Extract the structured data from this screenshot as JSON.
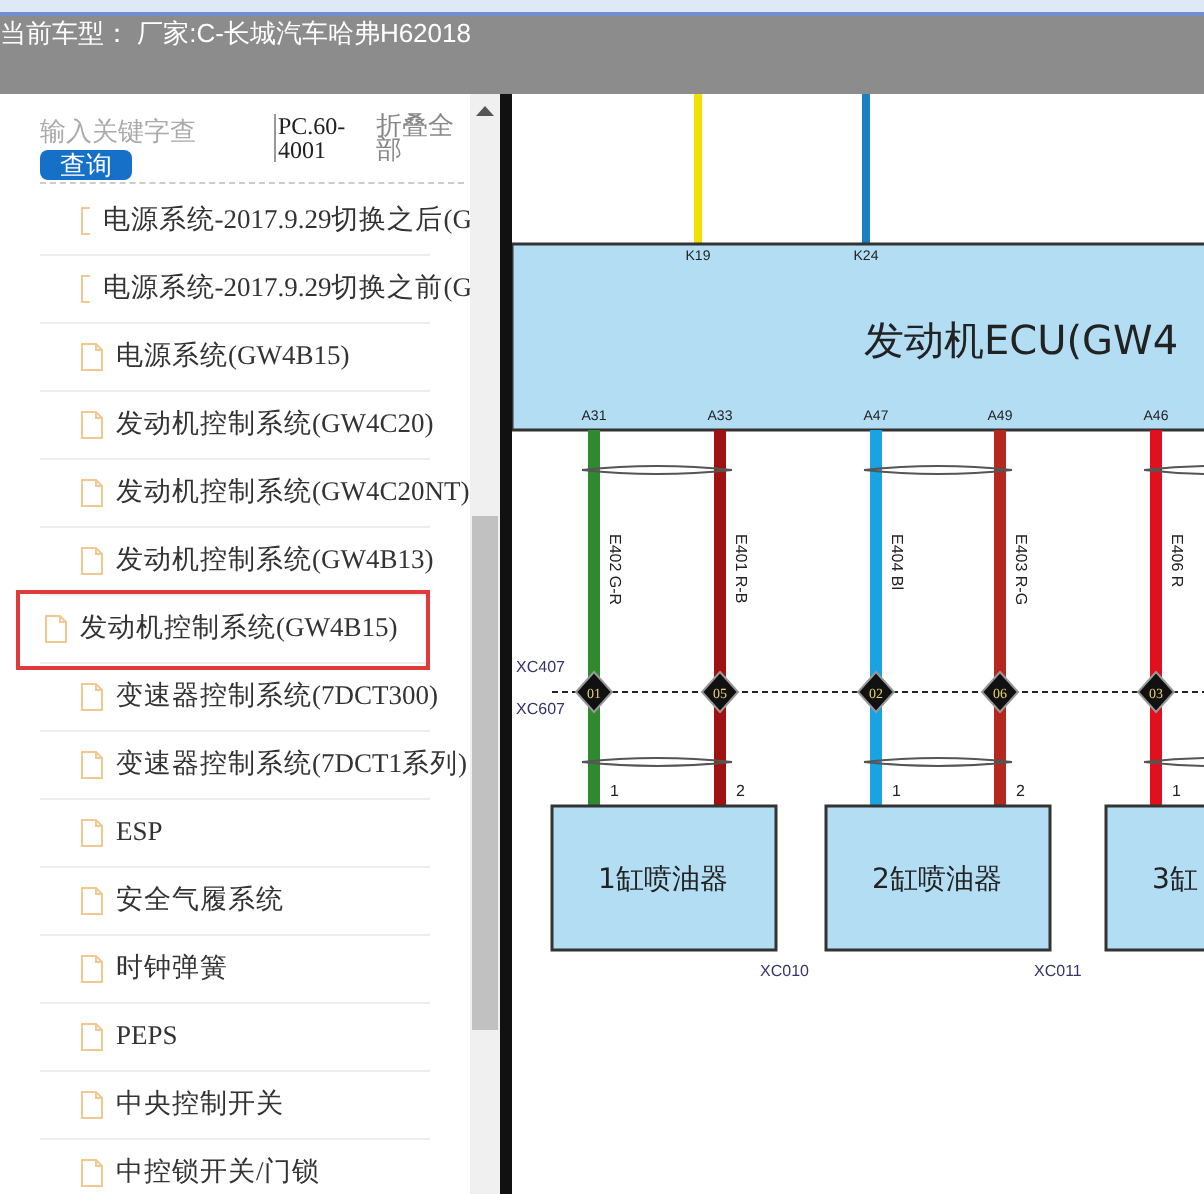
{
  "header": {
    "title": "当前车型： 厂家:C-长城汽车哈弗H62018"
  },
  "sidebar": {
    "search": {
      "placeholder": "输入关键字查"
    },
    "search_button": "查询",
    "code": "PC.60-4001",
    "collapse_all": "折叠全部",
    "items": [
      {
        "label": "电源系统-2017.9.29切换之后(G",
        "selected": false
      },
      {
        "label": "电源系统-2017.9.29切换之前(G",
        "selected": false
      },
      {
        "label": "电源系统(GW4B15)",
        "selected": false
      },
      {
        "label": "发动机控制系统(GW4C20)",
        "selected": false
      },
      {
        "label": "发动机控制系统(GW4C20NT)",
        "selected": false
      },
      {
        "label": "发动机控制系统(GW4B13)",
        "selected": false
      },
      {
        "label": "发动机控制系统(GW4B15)",
        "selected": true
      },
      {
        "label": "变速器控制系统(7DCT300)",
        "selected": false
      },
      {
        "label": "变速器控制系统(7DCT1系列)",
        "selected": false
      },
      {
        "label": "ESP",
        "selected": false
      },
      {
        "label": "安全气履系统",
        "selected": false
      },
      {
        "label": "时钟弹簧",
        "selected": false
      },
      {
        "label": "PEPS",
        "selected": false
      },
      {
        "label": "中央控制开关",
        "selected": false
      },
      {
        "label": "中控锁开关/门锁",
        "selected": false
      }
    ]
  },
  "diagram": {
    "ecu": {
      "title": "发动机ECU(GW4",
      "top_pins": [
        {
          "pin": "K19",
          "color": "#f2e000"
        },
        {
          "pin": "K24",
          "color": "#1a7fc0"
        }
      ]
    },
    "connector_labels": [
      "XC407",
      "XC607"
    ],
    "wires": [
      {
        "pin": "A31",
        "label": "E402 G-R",
        "splice": "01",
        "pin_number": "1",
        "color": "#2f8a2f"
      },
      {
        "pin": "A33",
        "label": "E401 R-B",
        "splice": "05",
        "pin_number": "2",
        "color": "#a01212"
      },
      {
        "pin": "A47",
        "label": "E404 Bl",
        "splice": "02",
        "pin_number": "1",
        "color": "#1aa3e0"
      },
      {
        "pin": "A49",
        "label": "E403 R-G",
        "splice": "06",
        "pin_number": "2",
        "color": "#b5281e"
      },
      {
        "pin": "A46",
        "label": "E406 R",
        "splice": "03",
        "pin_number": "1",
        "color": "#e0101e"
      }
    ],
    "injectors": [
      {
        "name": "1缸喷油器",
        "code": "XC010"
      },
      {
        "name": "2缸喷油器",
        "code": "XC011"
      },
      {
        "name": "3缸"
      }
    ]
  }
}
